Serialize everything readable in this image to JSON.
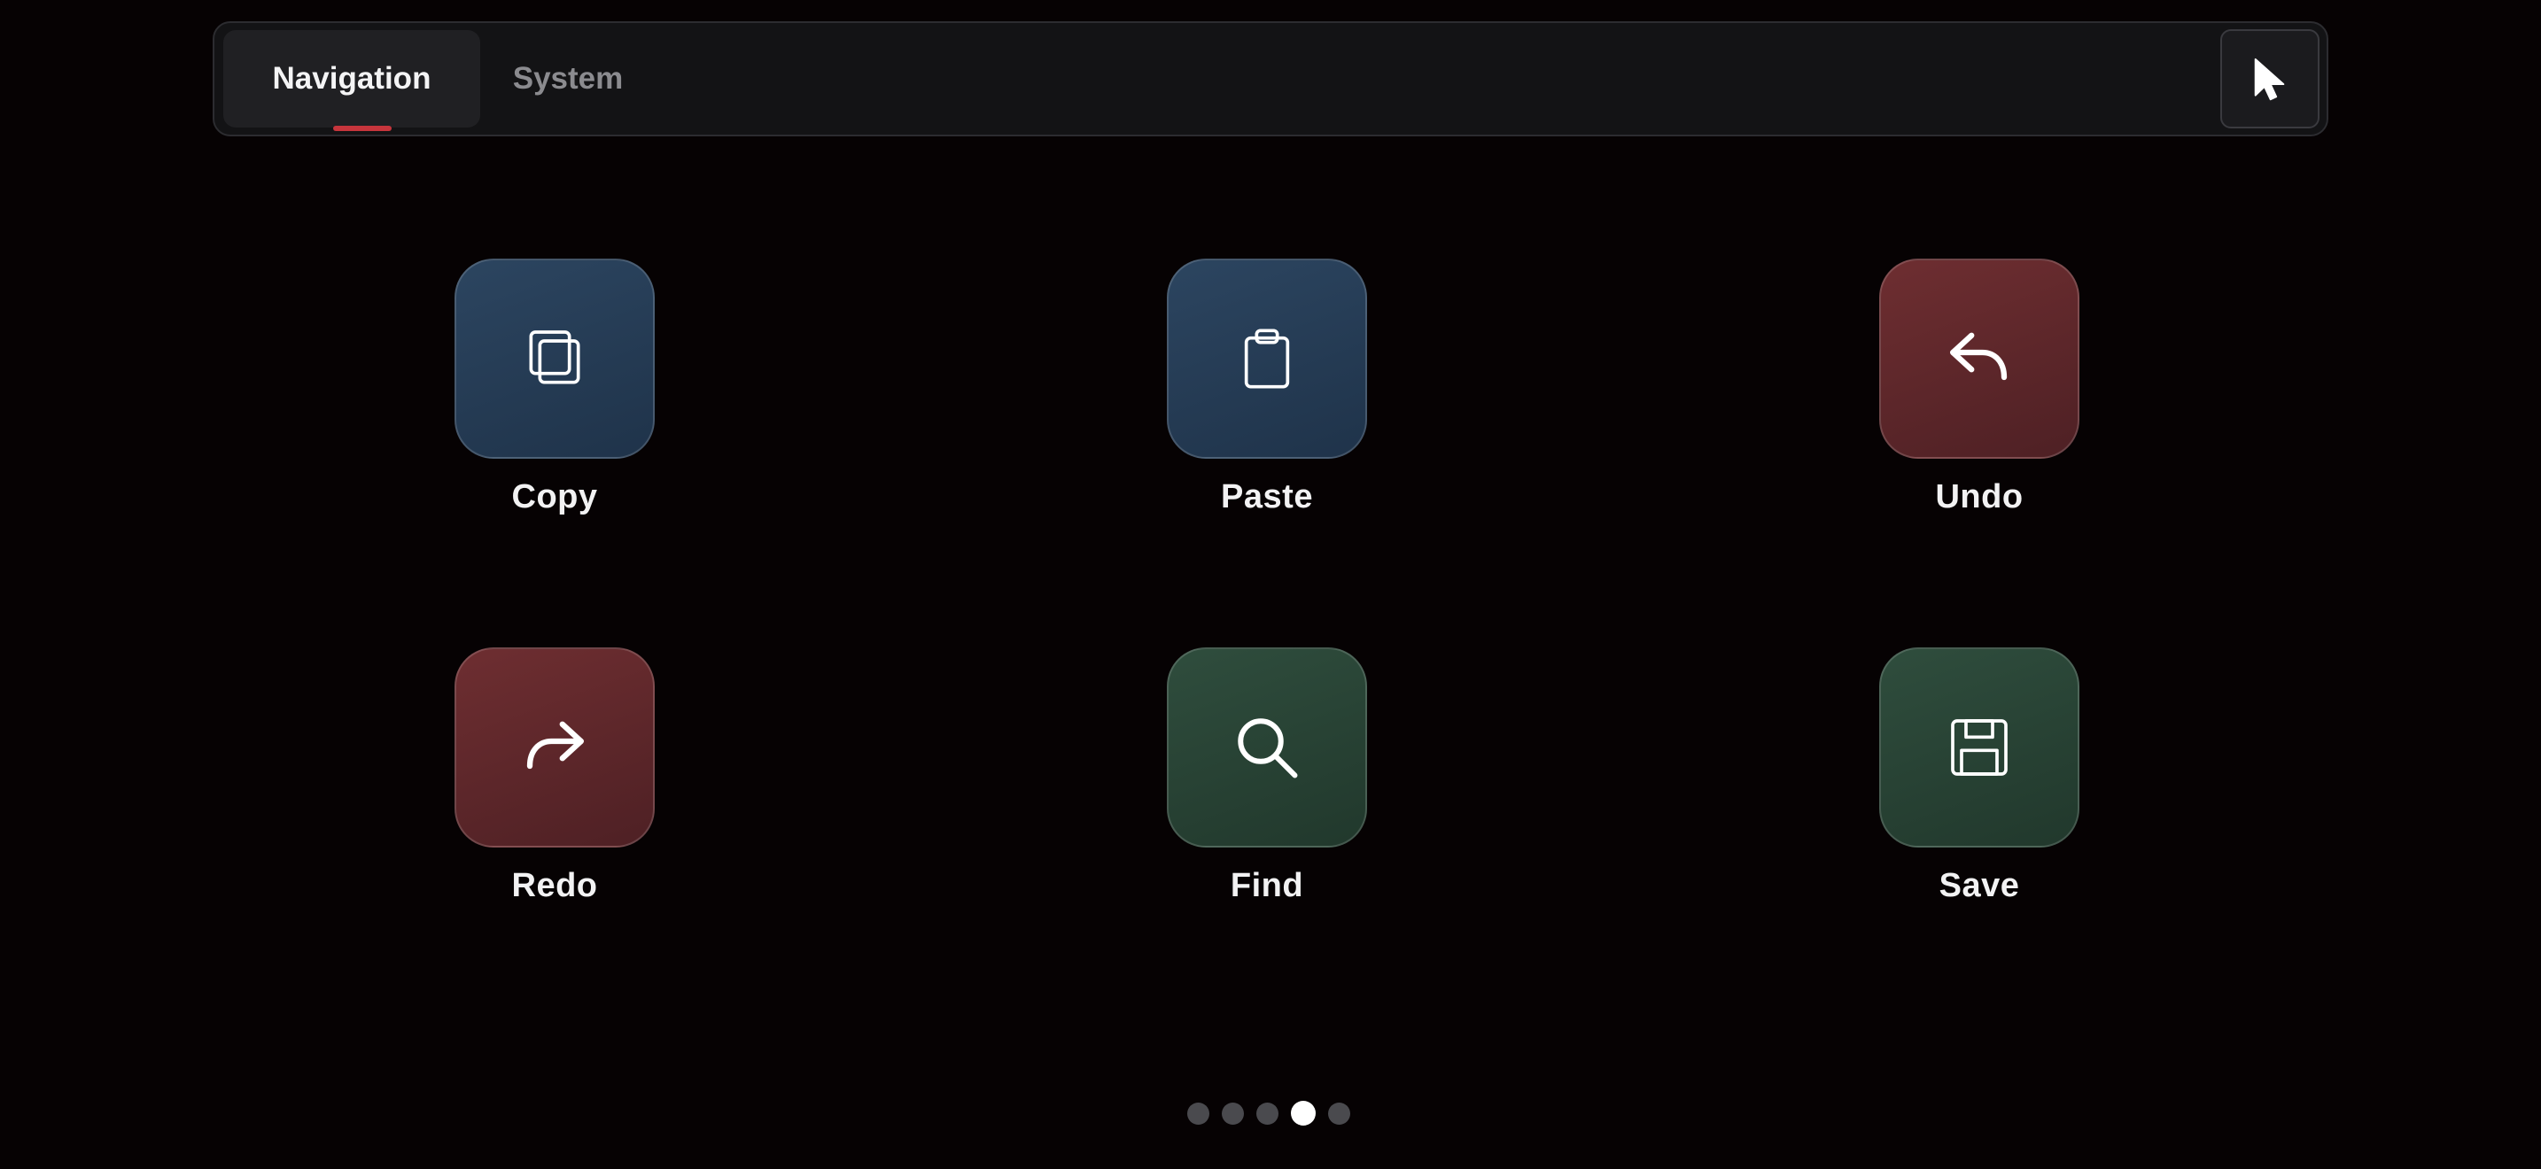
{
  "tabs": [
    {
      "label": "Navigation",
      "active": true
    },
    {
      "label": "System",
      "active": false
    }
  ],
  "toolbar": {
    "pointer_icon": "cursor-arrow-icon"
  },
  "tiles": [
    {
      "label": "Copy",
      "icon": "copy-icon",
      "color": "#2c4560"
    },
    {
      "label": "Paste",
      "icon": "paste-icon",
      "color": "#2c4560"
    },
    {
      "label": "Undo",
      "icon": "undo-icon",
      "color": "#6e2e31"
    },
    {
      "label": "Redo",
      "icon": "redo-icon",
      "color": "#6e2e31"
    },
    {
      "label": "Find",
      "icon": "search-icon",
      "color": "#2f4d3d"
    },
    {
      "label": "Save",
      "icon": "save-icon",
      "color": "#2f4d3d"
    }
  ],
  "pagination": {
    "total_pages": 5,
    "current_page": 4
  },
  "colors": {
    "background": "#060203",
    "accent": "#c6353c",
    "dot_active": "#ffffff",
    "dot_inactive": "#4a4a4e"
  }
}
